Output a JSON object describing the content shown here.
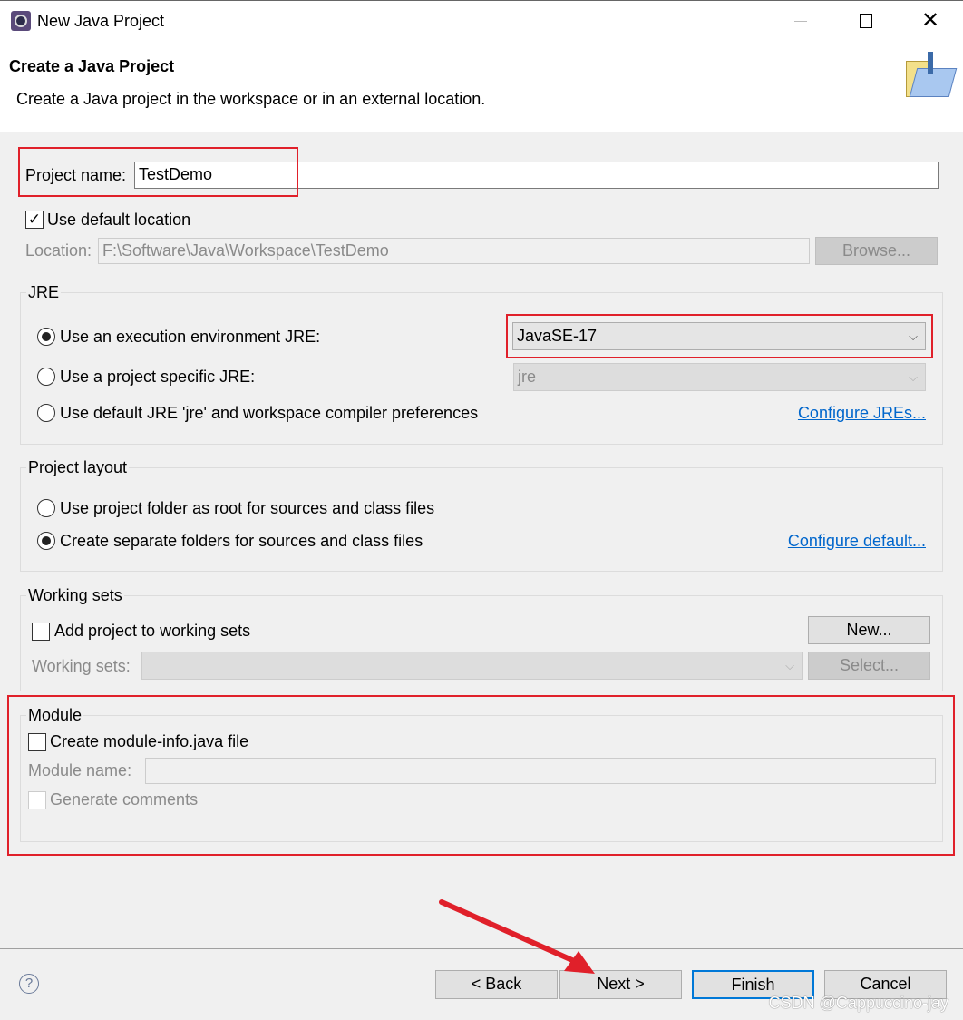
{
  "window": {
    "title": "New Java Project",
    "app_icon": "eclipse-icon",
    "controls": [
      "minimize",
      "maximize",
      "close"
    ]
  },
  "header": {
    "title": "Create a Java Project",
    "subtitle": "Create a Java project in the workspace or in an external location.",
    "icon": "java-project-folder-icon"
  },
  "project": {
    "name_label": "Project name:",
    "name_value": "TestDemo",
    "use_default_label": "Use default location",
    "use_default_checked": true,
    "location_label": "Location:",
    "location_value": "F:\\Software\\Java\\Workspace\\TestDemo",
    "browse_label": "Browse..."
  },
  "jre": {
    "legend": "JRE",
    "option1": "Use an execution environment JRE:",
    "option1_value": "JavaSE-17",
    "option2": "Use a project specific JRE:",
    "option2_value": "jre",
    "option3": "Use default JRE 'jre' and workspace compiler preferences",
    "selected": 1,
    "configure_link": "Configure JREs..."
  },
  "layout": {
    "legend": "Project layout",
    "option1": "Use project folder as root for sources and class files",
    "option2": "Create separate folders for sources and class files",
    "selected": 2,
    "configure_link": "Configure default..."
  },
  "working_sets": {
    "legend": "Working sets",
    "add_label": "Add project to working sets",
    "add_checked": false,
    "new_label": "New...",
    "sets_label": "Working sets:",
    "select_label": "Select..."
  },
  "module": {
    "legend": "Module",
    "create_label": "Create module-info.java file",
    "create_checked": false,
    "name_label": "Module name:",
    "comments_label": "Generate comments"
  },
  "footer": {
    "back": "< Back",
    "next": "Next >",
    "finish": "Finish",
    "cancel": "Cancel"
  },
  "watermark": "CSDN @Cappuccino-jay",
  "colors": {
    "annotation_red": "#e0202a",
    "link": "#0066cc",
    "default_button_border": "#0078d7"
  }
}
